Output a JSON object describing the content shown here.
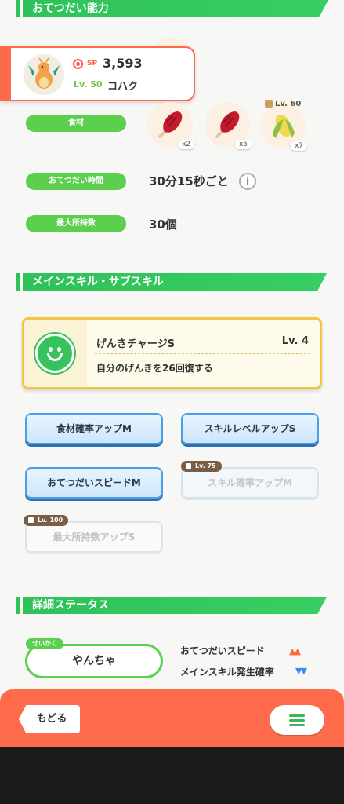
{
  "sections": {
    "helper_ability": "おてつだい能力",
    "main_sub_skill": "メインスキル・サブスキル",
    "detail_status": "詳細ステータス"
  },
  "pokemon": {
    "sp_label": "SP",
    "sp_value": "3,593",
    "level": "Lv. 50",
    "name": "コハク"
  },
  "stats": {
    "ingredients_label": "食材",
    "help_time_label": "おてつだい時間",
    "help_time_value": "30分15秒ごと",
    "max_carry_label": "最大所持数",
    "max_carry_value": "30個",
    "info_icon": "i"
  },
  "ingredients": [
    {
      "icon": "meat-icon",
      "count": "x2"
    },
    {
      "icon": "meat-icon",
      "count": "x5"
    },
    {
      "icon": "corn-icon",
      "count": "x7",
      "unlock": "Lv. 60"
    }
  ],
  "main_skill": {
    "name": "げんきチャージS",
    "level": "Lv. 4",
    "description": "自分のげんきを26回復する",
    "icon": "smile-icon"
  },
  "sub_skills": [
    {
      "label": "食材確率アップM",
      "locked": false
    },
    {
      "label": "スキルレベルアップS",
      "locked": false
    },
    {
      "label": "おてつだいスピードM",
      "locked": false
    },
    {
      "label": "スキル確率アップM",
      "locked": true,
      "unlock": "Lv. 75"
    },
    {
      "label": "最大所持数アップS",
      "locked": true,
      "unlock": "Lv. 100"
    }
  ],
  "nature": {
    "tag": "せいかく",
    "value": "やんちゃ",
    "up_label": "おてつだいスピード",
    "up_arrows": "▲▲",
    "down_label": "メインスキル発生確率",
    "down_arrows": "▼▼"
  },
  "footer": {
    "back_label": "もどる",
    "menu_icon": "hamburger-icon"
  },
  "colors": {
    "accent_green": "#2fc15a",
    "accent_orange": "#ff6b4b",
    "skill_gold": "#f6c445",
    "sub_skill_blue": "#4a9ee6"
  }
}
